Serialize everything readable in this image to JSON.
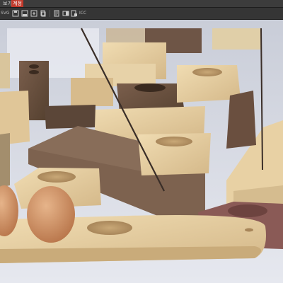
{
  "menubar": {
    "item_view": "보기",
    "item_account": "계정"
  },
  "toolbar": {
    "label_svg": "SVG",
    "label_icc": "ICC"
  },
  "photo": {
    "subject": "wooden-incense-holders-and-egg-holder",
    "colors": {
      "background": "#dfe2ec",
      "walnut": "#6a5040",
      "ash": "#e3cc9e",
      "egg": "#c98d5a"
    }
  }
}
